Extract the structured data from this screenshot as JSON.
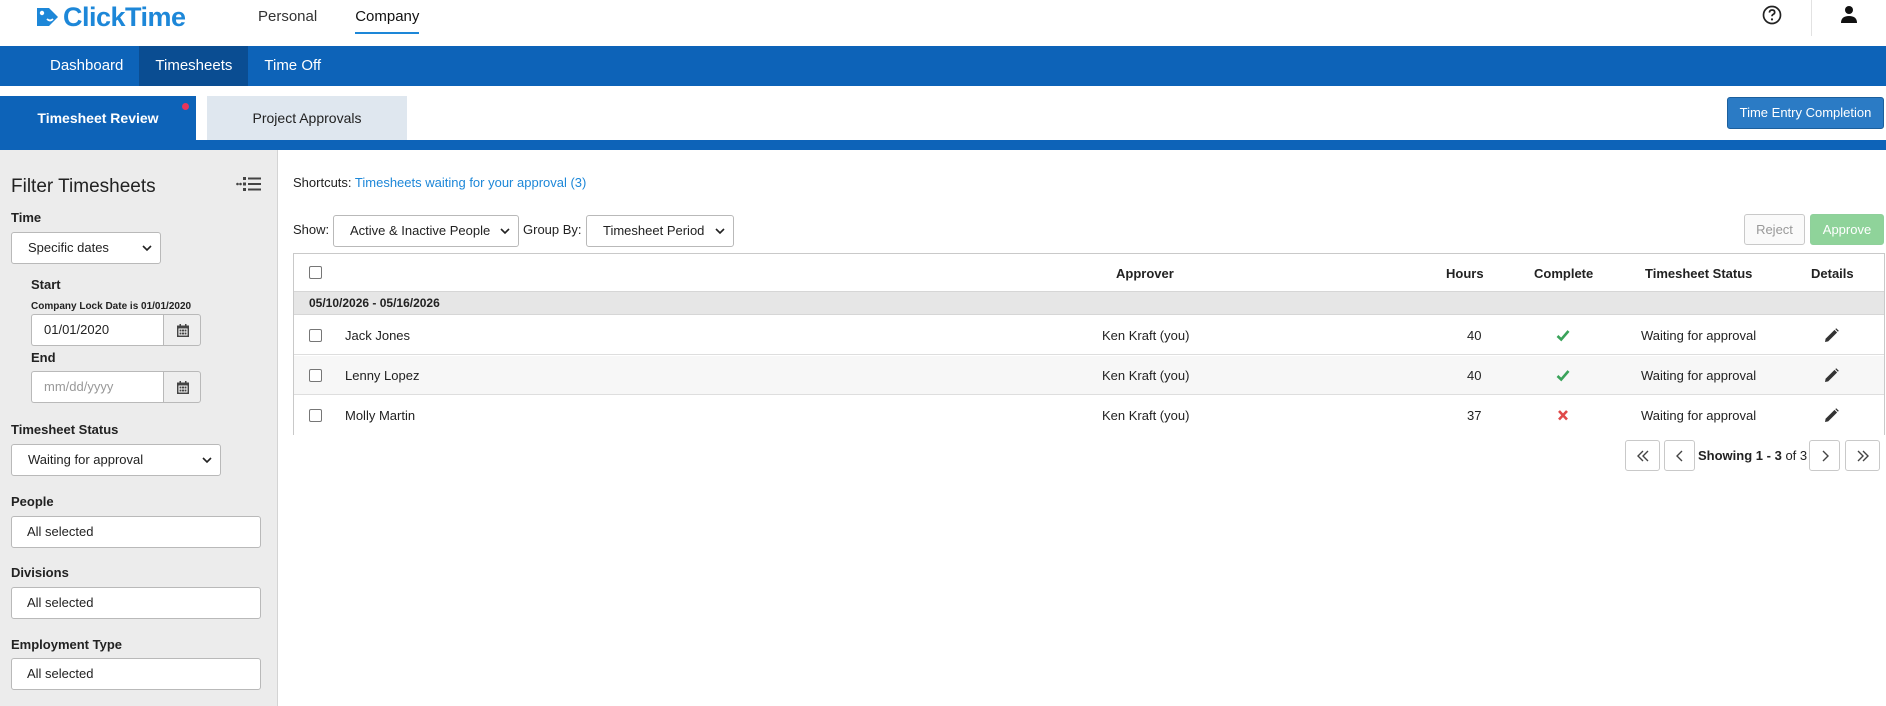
{
  "app": {
    "logo_text": "ClickTime",
    "colors": {
      "brand": "#1d87d8",
      "nav_blue": "#0d63b8",
      "approve_green": "#8fd39a",
      "check_green": "#3aa35a",
      "cross_red": "#e04a4a"
    }
  },
  "top_nav": {
    "items": [
      {
        "label": "Personal",
        "active": false
      },
      {
        "label": "Company",
        "active": true
      }
    ],
    "icons": {
      "help": "question-circle-icon",
      "user": "user-icon"
    }
  },
  "main_nav": {
    "items": [
      {
        "label": "Dashboard",
        "active": false
      },
      {
        "label": "Timesheets",
        "active": true
      },
      {
        "label": "Time Off",
        "active": false
      }
    ]
  },
  "sub_tabs": {
    "items": [
      {
        "label": "Timesheet Review",
        "active": true,
        "has_notification_dot": true
      },
      {
        "label": "Project Approvals",
        "active": false
      }
    ],
    "completion_button": "Time Entry Completion"
  },
  "filters": {
    "title": "Filter Timesheets",
    "time": {
      "label": "Time",
      "selected": "Specific dates"
    },
    "start": {
      "label": "Start",
      "lock_note": "Company Lock Date is 01/01/2020",
      "value": "01/01/2020"
    },
    "end": {
      "label": "End",
      "placeholder": "mm/dd/yyyy"
    },
    "timesheet_status": {
      "label": "Timesheet Status",
      "selected": "Waiting for approval"
    },
    "people": {
      "label": "People",
      "value": "All selected"
    },
    "divisions": {
      "label": "Divisions",
      "value": "All selected"
    },
    "employment_type": {
      "label": "Employment Type",
      "value": "All selected"
    }
  },
  "main": {
    "shortcuts_label": "Shortcuts:",
    "shortcut_link": "Timesheets waiting for your approval (3)",
    "show_label": "Show:",
    "show_selected": "Active & Inactive People",
    "group_by_label": "Group By:",
    "group_by_selected": "Timesheet Period",
    "reject_label": "Reject",
    "approve_label": "Approve"
  },
  "table": {
    "columns": [
      "Approver",
      "Hours",
      "Complete",
      "Timesheet Status",
      "Details"
    ],
    "group_label": "05/10/2026 - 05/16/2026",
    "rows": [
      {
        "name": "Jack Jones",
        "approver": "Ken Kraft (you)",
        "hours": "40",
        "complete": true,
        "status": "Waiting for approval"
      },
      {
        "name": "Lenny Lopez",
        "approver": "Ken Kraft (you)",
        "hours": "40",
        "complete": true,
        "status": "Waiting for approval"
      },
      {
        "name": "Molly Martin",
        "approver": "Ken Kraft (you)",
        "hours": "37",
        "complete": false,
        "status": "Waiting for approval"
      }
    ]
  },
  "pagination": {
    "prefix": "Showing",
    "range": "1 - 3",
    "of_text": "of 3"
  }
}
